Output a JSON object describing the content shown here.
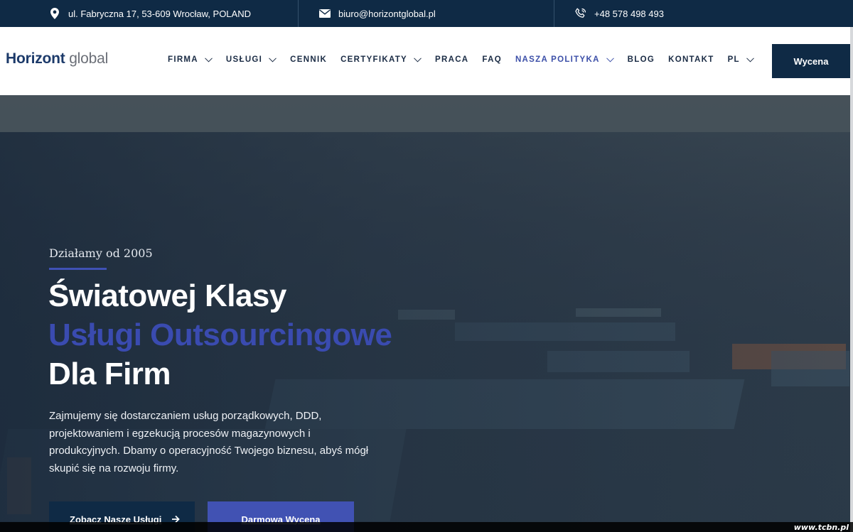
{
  "topbar": {
    "address": "ul. Fabryczna 17, 53-609 Wrocław, POLAND",
    "email": "biuro@horizontglobal.pl",
    "phone": "+48 578 498 493"
  },
  "header": {
    "logo_bold": "Horizont",
    "logo_light": " global",
    "nav": [
      {
        "label": "FIRMA",
        "dropdown": true
      },
      {
        "label": "USŁUGI",
        "dropdown": true
      },
      {
        "label": "CENNIK",
        "dropdown": false
      },
      {
        "label": "CERTYFIKATY",
        "dropdown": true
      },
      {
        "label": "PRACA",
        "dropdown": false
      },
      {
        "label": "FAQ",
        "dropdown": false
      },
      {
        "label": "NASZA POLITYKA",
        "dropdown": true,
        "active": true
      },
      {
        "label": "BLOG",
        "dropdown": false
      },
      {
        "label": "KONTAKT",
        "dropdown": false
      },
      {
        "label": "PL",
        "dropdown": true
      }
    ],
    "cta_label": "Wycena"
  },
  "hero": {
    "kicker": "Działamy od 2005",
    "title_line1": "Światowej Klasy",
    "title_line2": "Usługi Outsourcingowe",
    "title_line3": "Dla Firm",
    "description": "Zajmujemy się dostarczaniem usług porządkowych, DDD, projektowaniem i egzekucją procesów magazynowych i produkcyjnych. Dbamy o operacyjność Twojego biznesu, abyś mógł skupić się na rozwoju firmy.",
    "primary_button": "Zobacz Nasze Usługi",
    "secondary_button": "Darmowa Wycena"
  },
  "watermark": "www.tcbn.pl",
  "colors": {
    "navy": "#0f2a45",
    "accent": "#3f51b5",
    "active_nav": "#3c4fa8"
  },
  "icons": {
    "address": "map-pin-icon",
    "email": "envelope-icon",
    "phone": "phone-icon",
    "dropdown": "chevron-down-icon",
    "button_arrow": "arrow-right-icon"
  }
}
